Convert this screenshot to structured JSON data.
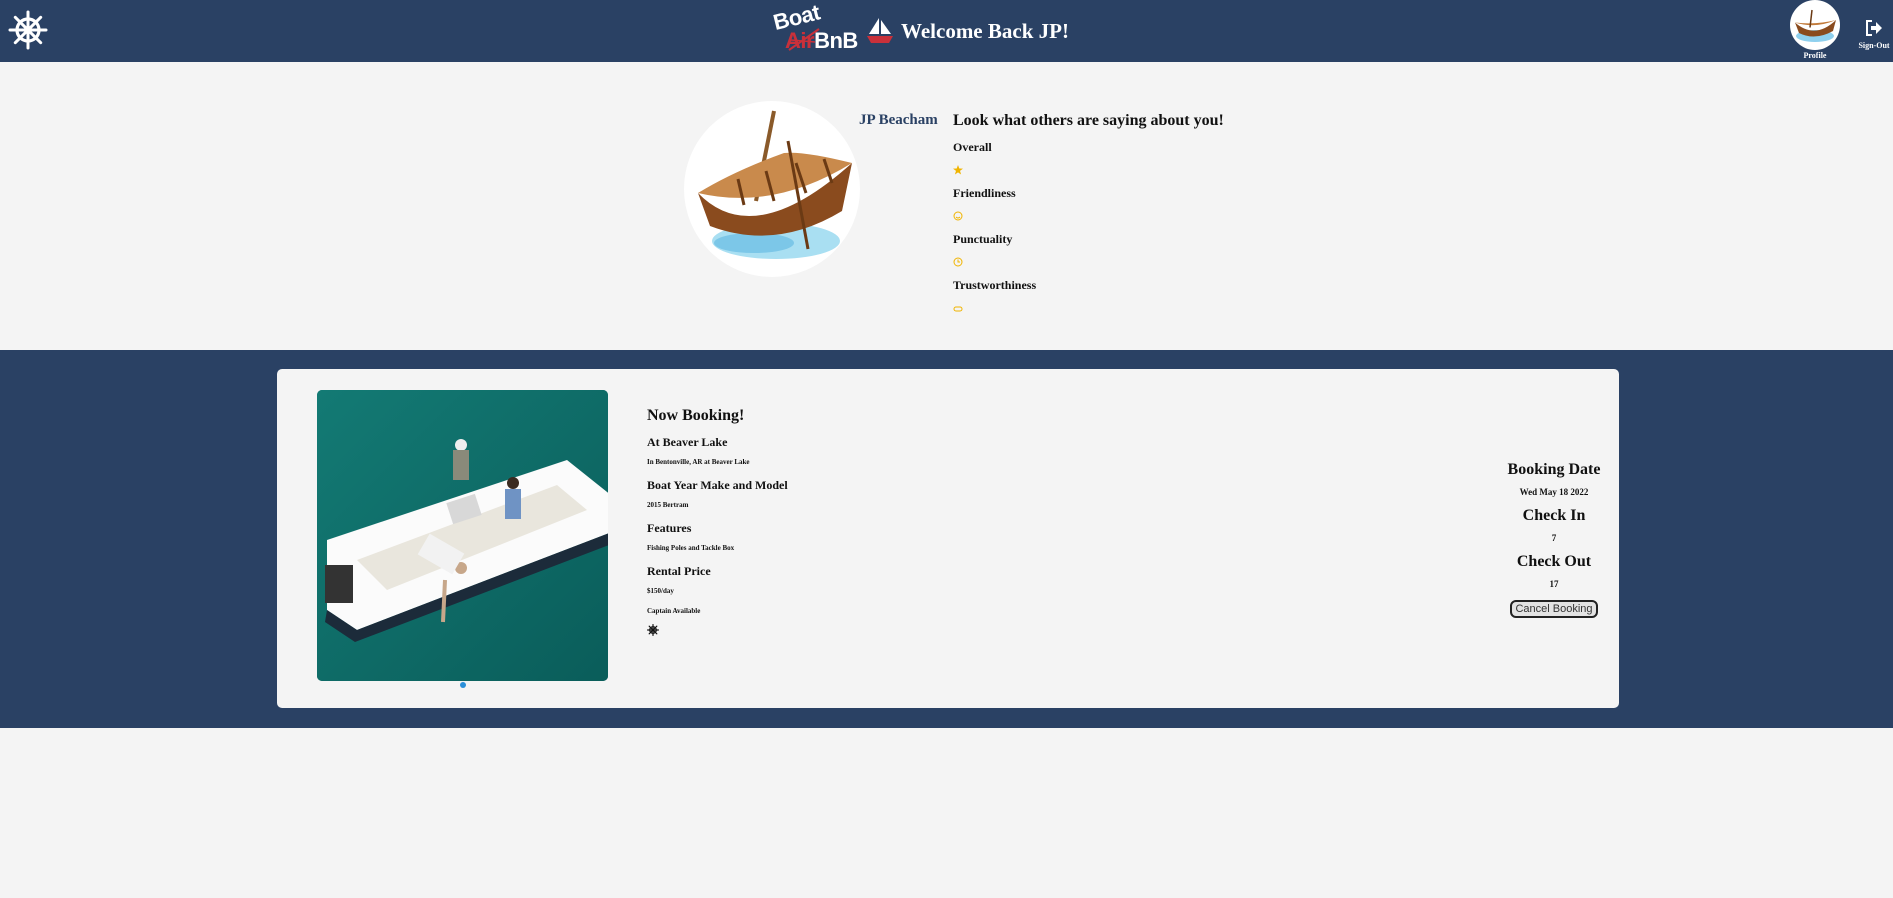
{
  "header": {
    "logo_top_word": "Boat",
    "logo_struck_word": "Air",
    "logo_bottom_word": "BnB",
    "welcome": "Welcome Back JP!",
    "profile_label": "Profile",
    "signout_label": "Sign-Out",
    "wheel_icon": "ship-wheel-icon",
    "signout_icon": "sign-out-icon"
  },
  "profile": {
    "name": "JP Beacham",
    "reviews_heading": "Look what others are saying about you!",
    "ratings": [
      {
        "label": "Overall",
        "icon": "star-icon"
      },
      {
        "label": "Friendliness",
        "icon": "smile-icon"
      },
      {
        "label": "Punctuality",
        "icon": "clock-icon"
      },
      {
        "label": "Trustworthiness",
        "icon": "handshake-icon"
      }
    ],
    "rating_color": "#f0b400"
  },
  "booking": {
    "title": "Now Booking!",
    "location_heading": "At Beaver Lake",
    "location_detail": "In Bentonville, AR at Beaver Lake",
    "boat_heading": "Boat Year Make and Model",
    "boat_detail": "2015 Bertram",
    "features_heading": "Features",
    "features_detail": "Fishing Poles and Tackle Box",
    "price_heading": "Rental Price",
    "price_detail": "$150/day",
    "captain": "Captain Available",
    "booking_date_heading": "Booking Date",
    "booking_date": "Wed May 18 2022",
    "check_in_heading": "Check In",
    "check_in": "7",
    "check_out_heading": "Check Out",
    "check_out": "17",
    "cancel_label": "Cancel Booking"
  },
  "colors": {
    "navy": "#2a4164",
    "background": "#f4f4f4",
    "accent_dot": "#2a8fd9",
    "logo_red": "#c9303a"
  }
}
